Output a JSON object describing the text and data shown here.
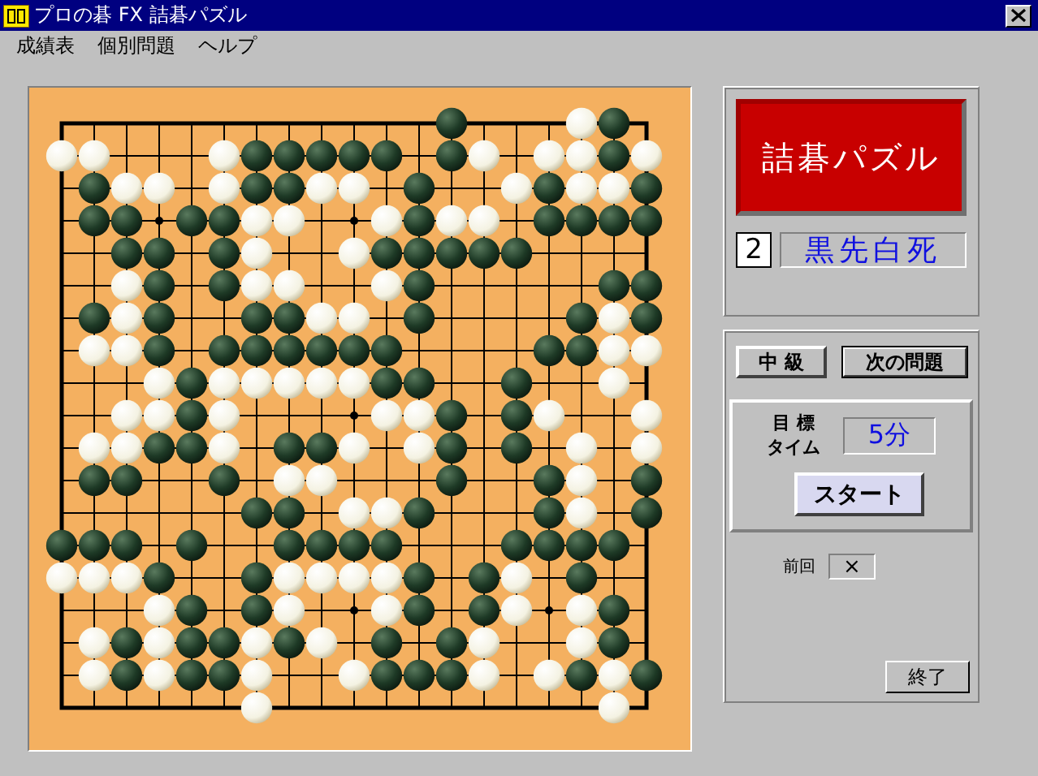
{
  "window": {
    "title": "プロの碁 FX 詰碁パズル"
  },
  "menu": [
    {
      "label": "成績表"
    },
    {
      "label": "個別問題"
    },
    {
      "label": "ヘルプ"
    }
  ],
  "board": {
    "rows": [
      {
        "cells": [
          {
            "kind": "empty"
          },
          {
            "kind": "empty"
          },
          {
            "kind": "empty"
          },
          {
            "kind": "empty"
          },
          {
            "kind": "empty"
          },
          {
            "kind": "empty"
          },
          {
            "kind": "empty"
          },
          {
            "kind": "empty"
          },
          {
            "kind": "empty"
          },
          {
            "kind": "empty"
          },
          {
            "kind": "empty"
          },
          {
            "kind": "empty"
          },
          {
            "kind": "black"
          },
          {
            "kind": "empty"
          },
          {
            "kind": "empty"
          },
          {
            "kind": "empty"
          },
          {
            "kind": "white"
          },
          {
            "kind": "black"
          },
          {
            "kind": "empty"
          }
        ]
      },
      {
        "cells": [
          {
            "kind": "white"
          },
          {
            "kind": "white"
          },
          {
            "kind": "empty"
          },
          {
            "kind": "empty"
          },
          {
            "kind": "empty"
          },
          {
            "kind": "white"
          },
          {
            "kind": "black"
          },
          {
            "kind": "black"
          },
          {
            "kind": "black"
          },
          {
            "kind": "black"
          },
          {
            "kind": "black"
          },
          {
            "kind": "empty"
          },
          {
            "kind": "black"
          },
          {
            "kind": "white"
          },
          {
            "kind": "empty"
          },
          {
            "kind": "white"
          },
          {
            "kind": "white"
          },
          {
            "kind": "black"
          },
          {
            "kind": "white"
          }
        ]
      },
      {
        "cells": [
          {
            "kind": "empty"
          },
          {
            "kind": "black"
          },
          {
            "kind": "white"
          },
          {
            "kind": "white"
          },
          {
            "kind": "empty"
          },
          {
            "kind": "white"
          },
          {
            "kind": "black"
          },
          {
            "kind": "black"
          },
          {
            "kind": "white"
          },
          {
            "kind": "white"
          },
          {
            "kind": "empty"
          },
          {
            "kind": "black"
          },
          {
            "kind": "empty"
          },
          {
            "kind": "empty"
          },
          {
            "kind": "white"
          },
          {
            "kind": "black"
          },
          {
            "kind": "white"
          },
          {
            "kind": "white"
          },
          {
            "kind": "black"
          }
        ]
      },
      {
        "cells": [
          {
            "kind": "empty"
          },
          {
            "kind": "black"
          },
          {
            "kind": "black"
          },
          {
            "kind": "empty"
          },
          {
            "kind": "black"
          },
          {
            "kind": "black"
          },
          {
            "kind": "white"
          },
          {
            "kind": "white"
          },
          {
            "kind": "empty"
          },
          {
            "kind": "empty"
          },
          {
            "kind": "white"
          },
          {
            "kind": "black"
          },
          {
            "kind": "white"
          },
          {
            "kind": "white"
          },
          {
            "kind": "empty"
          },
          {
            "kind": "black"
          },
          {
            "kind": "black"
          },
          {
            "kind": "black"
          },
          {
            "kind": "black"
          }
        ]
      },
      {
        "cells": [
          {
            "kind": "empty"
          },
          {
            "kind": "empty"
          },
          {
            "kind": "black"
          },
          {
            "kind": "black"
          },
          {
            "kind": "empty"
          },
          {
            "kind": "black"
          },
          {
            "kind": "white"
          },
          {
            "kind": "empty"
          },
          {
            "kind": "empty"
          },
          {
            "kind": "white"
          },
          {
            "kind": "black"
          },
          {
            "kind": "black"
          },
          {
            "kind": "black"
          },
          {
            "kind": "black"
          },
          {
            "kind": "black"
          },
          {
            "kind": "empty"
          },
          {
            "kind": "empty"
          },
          {
            "kind": "empty"
          },
          {
            "kind": "empty"
          }
        ]
      },
      {
        "cells": [
          {
            "kind": "empty"
          },
          {
            "kind": "empty"
          },
          {
            "kind": "white"
          },
          {
            "kind": "black"
          },
          {
            "kind": "empty"
          },
          {
            "kind": "black"
          },
          {
            "kind": "white"
          },
          {
            "kind": "white"
          },
          {
            "kind": "empty"
          },
          {
            "kind": "empty"
          },
          {
            "kind": "white"
          },
          {
            "kind": "black"
          },
          {
            "kind": "empty"
          },
          {
            "kind": "empty"
          },
          {
            "kind": "empty"
          },
          {
            "kind": "empty"
          },
          {
            "kind": "empty"
          },
          {
            "kind": "black"
          },
          {
            "kind": "black"
          }
        ]
      },
      {
        "cells": [
          {
            "kind": "empty"
          },
          {
            "kind": "black"
          },
          {
            "kind": "white"
          },
          {
            "kind": "black"
          },
          {
            "kind": "empty"
          },
          {
            "kind": "empty"
          },
          {
            "kind": "black"
          },
          {
            "kind": "black"
          },
          {
            "kind": "white"
          },
          {
            "kind": "white"
          },
          {
            "kind": "empty"
          },
          {
            "kind": "black"
          },
          {
            "kind": "empty"
          },
          {
            "kind": "empty"
          },
          {
            "kind": "empty"
          },
          {
            "kind": "empty"
          },
          {
            "kind": "black"
          },
          {
            "kind": "white"
          },
          {
            "kind": "black"
          }
        ]
      },
      {
        "cells": [
          {
            "kind": "empty"
          },
          {
            "kind": "white"
          },
          {
            "kind": "white"
          },
          {
            "kind": "black"
          },
          {
            "kind": "empty"
          },
          {
            "kind": "black"
          },
          {
            "kind": "black"
          },
          {
            "kind": "black"
          },
          {
            "kind": "black"
          },
          {
            "kind": "black"
          },
          {
            "kind": "black"
          },
          {
            "kind": "empty"
          },
          {
            "kind": "empty"
          },
          {
            "kind": "empty"
          },
          {
            "kind": "empty"
          },
          {
            "kind": "black"
          },
          {
            "kind": "black"
          },
          {
            "kind": "white"
          },
          {
            "kind": "white"
          }
        ]
      },
      {
        "cells": [
          {
            "kind": "empty"
          },
          {
            "kind": "empty"
          },
          {
            "kind": "empty"
          },
          {
            "kind": "white"
          },
          {
            "kind": "black"
          },
          {
            "kind": "white"
          },
          {
            "kind": "white"
          },
          {
            "kind": "white"
          },
          {
            "kind": "white"
          },
          {
            "kind": "white"
          },
          {
            "kind": "black"
          },
          {
            "kind": "black"
          },
          {
            "kind": "empty"
          },
          {
            "kind": "empty"
          },
          {
            "kind": "black"
          },
          {
            "kind": "empty"
          },
          {
            "kind": "empty"
          },
          {
            "kind": "white"
          },
          {
            "kind": "empty"
          }
        ]
      },
      {
        "cells": [
          {
            "kind": "empty"
          },
          {
            "kind": "empty"
          },
          {
            "kind": "white"
          },
          {
            "kind": "white"
          },
          {
            "kind": "black"
          },
          {
            "kind": "white"
          },
          {
            "kind": "empty"
          },
          {
            "kind": "empty"
          },
          {
            "kind": "empty"
          },
          {
            "kind": "empty"
          },
          {
            "kind": "white"
          },
          {
            "kind": "white"
          },
          {
            "kind": "black"
          },
          {
            "kind": "empty"
          },
          {
            "kind": "black"
          },
          {
            "kind": "white"
          },
          {
            "kind": "empty"
          },
          {
            "kind": "empty"
          },
          {
            "kind": "white"
          }
        ]
      },
      {
        "cells": [
          {
            "kind": "empty"
          },
          {
            "kind": "white"
          },
          {
            "kind": "white"
          },
          {
            "kind": "black"
          },
          {
            "kind": "black"
          },
          {
            "kind": "white"
          },
          {
            "kind": "empty"
          },
          {
            "kind": "black"
          },
          {
            "kind": "black"
          },
          {
            "kind": "white"
          },
          {
            "kind": "empty"
          },
          {
            "kind": "white"
          },
          {
            "kind": "black"
          },
          {
            "kind": "empty"
          },
          {
            "kind": "black"
          },
          {
            "kind": "empty"
          },
          {
            "kind": "white"
          },
          {
            "kind": "empty"
          },
          {
            "kind": "white"
          }
        ]
      },
      {
        "cells": [
          {
            "kind": "empty"
          },
          {
            "kind": "black"
          },
          {
            "kind": "black"
          },
          {
            "kind": "empty"
          },
          {
            "kind": "empty"
          },
          {
            "kind": "black"
          },
          {
            "kind": "empty"
          },
          {
            "kind": "white"
          },
          {
            "kind": "white"
          },
          {
            "kind": "empty"
          },
          {
            "kind": "empty"
          },
          {
            "kind": "empty"
          },
          {
            "kind": "black"
          },
          {
            "kind": "empty"
          },
          {
            "kind": "empty"
          },
          {
            "kind": "black"
          },
          {
            "kind": "white"
          },
          {
            "kind": "empty"
          },
          {
            "kind": "black"
          }
        ]
      },
      {
        "cells": [
          {
            "kind": "empty"
          },
          {
            "kind": "empty"
          },
          {
            "kind": "empty"
          },
          {
            "kind": "empty"
          },
          {
            "kind": "empty"
          },
          {
            "kind": "empty"
          },
          {
            "kind": "black"
          },
          {
            "kind": "black"
          },
          {
            "kind": "empty"
          },
          {
            "kind": "white"
          },
          {
            "kind": "white"
          },
          {
            "kind": "black"
          },
          {
            "kind": "empty"
          },
          {
            "kind": "empty"
          },
          {
            "kind": "empty"
          },
          {
            "kind": "black"
          },
          {
            "kind": "white"
          },
          {
            "kind": "empty"
          },
          {
            "kind": "black"
          }
        ]
      },
      {
        "cells": [
          {
            "kind": "black"
          },
          {
            "kind": "black"
          },
          {
            "kind": "black"
          },
          {
            "kind": "empty"
          },
          {
            "kind": "black"
          },
          {
            "kind": "empty"
          },
          {
            "kind": "empty"
          },
          {
            "kind": "black"
          },
          {
            "kind": "black"
          },
          {
            "kind": "black"
          },
          {
            "kind": "black"
          },
          {
            "kind": "empty"
          },
          {
            "kind": "empty"
          },
          {
            "kind": "empty"
          },
          {
            "kind": "black"
          },
          {
            "kind": "black"
          },
          {
            "kind": "black"
          },
          {
            "kind": "black"
          },
          {
            "kind": "empty"
          }
        ]
      },
      {
        "cells": [
          {
            "kind": "white"
          },
          {
            "kind": "white"
          },
          {
            "kind": "white"
          },
          {
            "kind": "black"
          },
          {
            "kind": "empty"
          },
          {
            "kind": "empty"
          },
          {
            "kind": "black"
          },
          {
            "kind": "white"
          },
          {
            "kind": "white"
          },
          {
            "kind": "white"
          },
          {
            "kind": "white"
          },
          {
            "kind": "black"
          },
          {
            "kind": "empty"
          },
          {
            "kind": "black"
          },
          {
            "kind": "white"
          },
          {
            "kind": "empty"
          },
          {
            "kind": "black"
          },
          {
            "kind": "empty"
          },
          {
            "kind": "empty"
          }
        ]
      },
      {
        "cells": [
          {
            "kind": "empty"
          },
          {
            "kind": "empty"
          },
          {
            "kind": "empty"
          },
          {
            "kind": "white"
          },
          {
            "kind": "black"
          },
          {
            "kind": "empty"
          },
          {
            "kind": "black"
          },
          {
            "kind": "white"
          },
          {
            "kind": "empty"
          },
          {
            "kind": "empty"
          },
          {
            "kind": "white"
          },
          {
            "kind": "black"
          },
          {
            "kind": "empty"
          },
          {
            "kind": "black"
          },
          {
            "kind": "white"
          },
          {
            "kind": "empty"
          },
          {
            "kind": "white"
          },
          {
            "kind": "black"
          },
          {
            "kind": "empty"
          }
        ]
      },
      {
        "cells": [
          {
            "kind": "empty"
          },
          {
            "kind": "white"
          },
          {
            "kind": "black"
          },
          {
            "kind": "white"
          },
          {
            "kind": "black"
          },
          {
            "kind": "black"
          },
          {
            "kind": "white"
          },
          {
            "kind": "black"
          },
          {
            "kind": "white"
          },
          {
            "kind": "empty"
          },
          {
            "kind": "black"
          },
          {
            "kind": "empty"
          },
          {
            "kind": "black"
          },
          {
            "kind": "white"
          },
          {
            "kind": "empty"
          },
          {
            "kind": "empty"
          },
          {
            "kind": "white"
          },
          {
            "kind": "black"
          },
          {
            "kind": "empty"
          }
        ]
      },
      {
        "cells": [
          {
            "kind": "empty"
          },
          {
            "kind": "white"
          },
          {
            "kind": "black"
          },
          {
            "kind": "white"
          },
          {
            "kind": "black"
          },
          {
            "kind": "black"
          },
          {
            "kind": "white"
          },
          {
            "kind": "empty"
          },
          {
            "kind": "empty"
          },
          {
            "kind": "white"
          },
          {
            "kind": "black"
          },
          {
            "kind": "black"
          },
          {
            "kind": "black"
          },
          {
            "kind": "white"
          },
          {
            "kind": "empty"
          },
          {
            "kind": "white"
          },
          {
            "kind": "black"
          },
          {
            "kind": "white"
          },
          {
            "kind": "black"
          }
        ]
      },
      {
        "cells": [
          {
            "kind": "empty"
          },
          {
            "kind": "empty"
          },
          {
            "kind": "empty"
          },
          {
            "kind": "empty"
          },
          {
            "kind": "empty"
          },
          {
            "kind": "empty"
          },
          {
            "kind": "white"
          },
          {
            "kind": "empty"
          },
          {
            "kind": "empty"
          },
          {
            "kind": "empty"
          },
          {
            "kind": "empty"
          },
          {
            "kind": "empty"
          },
          {
            "kind": "empty"
          },
          {
            "kind": "empty"
          },
          {
            "kind": "empty"
          },
          {
            "kind": "empty"
          },
          {
            "kind": "empty"
          },
          {
            "kind": "white"
          },
          {
            "kind": "empty"
          }
        ]
      }
    ]
  },
  "panel": {
    "logo": "詰碁パズル",
    "problem_number": "2",
    "problem_type": "黒先白死"
  },
  "controls": {
    "level_button": "中 級",
    "next_button": "次の問題",
    "target_label_1": "目 標",
    "target_label_2": "タイム",
    "target_time": "5分",
    "start_button": "スタート",
    "previous_label": "前回",
    "previous_result": "×",
    "quit_button": "終了"
  }
}
